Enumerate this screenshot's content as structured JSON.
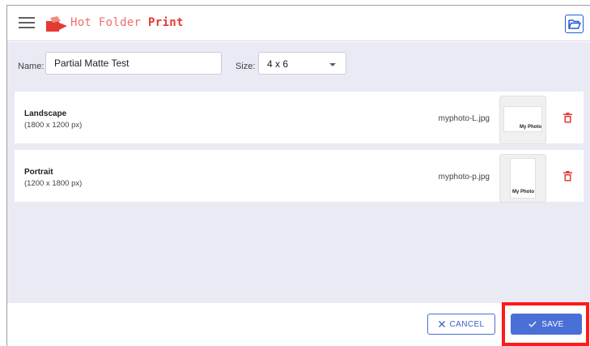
{
  "app": {
    "logo_word_1": "Hot Folder",
    "logo_word_2": "Print"
  },
  "form": {
    "name_label": "Name:",
    "name_value": "Partial Matte Test",
    "size_label": "Size:",
    "size_value": "4 x 6"
  },
  "rows": [
    {
      "title": "Landscape",
      "dims": "(1800 x 1200 px)",
      "file": "myphoto-L.jpg",
      "thumb_caption": "My Photo",
      "orientation": "landscape"
    },
    {
      "title": "Portrait",
      "dims": "(1200 x 1800 px)",
      "file": "myphoto-p.jpg",
      "thumb_caption": "My Photo",
      "orientation": "portrait"
    }
  ],
  "footer": {
    "cancel_label": "CANCEL",
    "save_label": "SAVE"
  },
  "colors": {
    "accent": "#4a6fd6",
    "brand": "#e53935",
    "delete": "#e53935",
    "highlight": "#ff1a1a"
  }
}
